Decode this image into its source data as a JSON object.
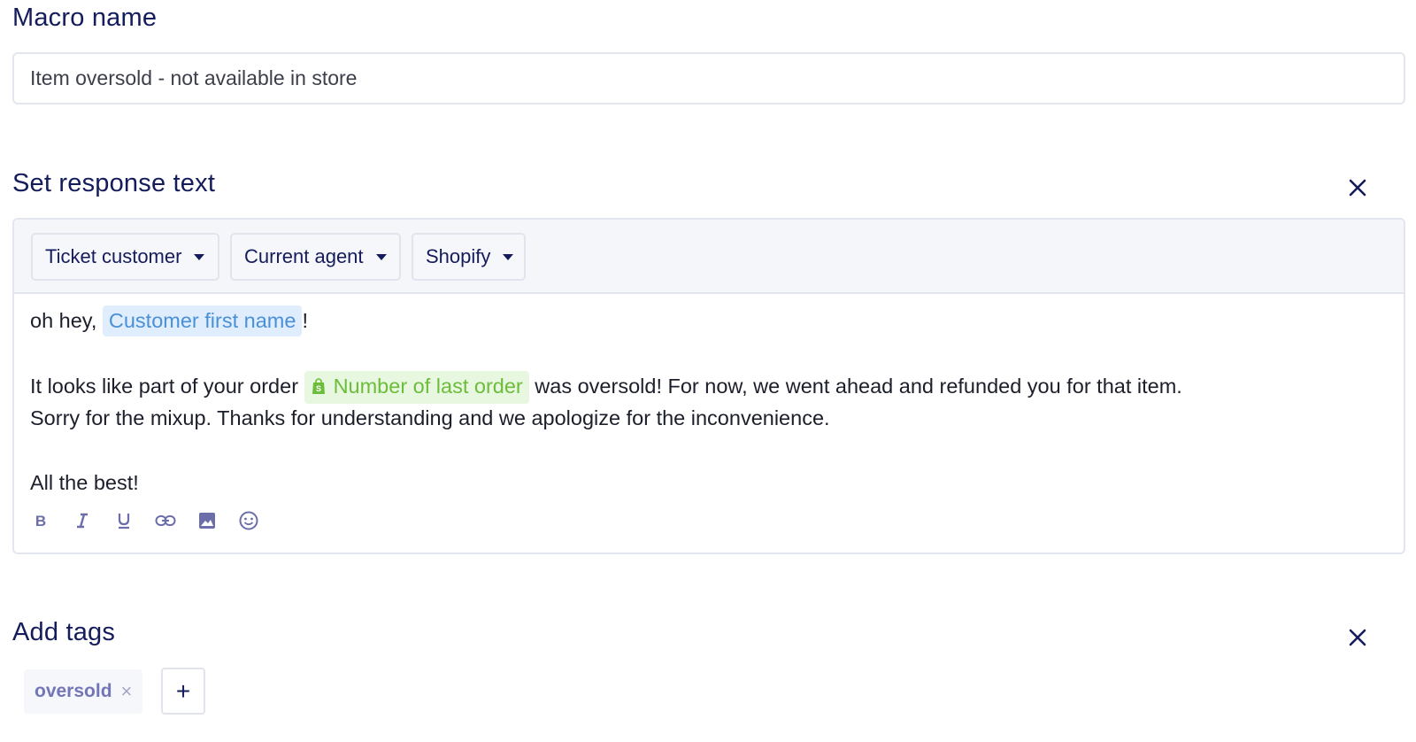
{
  "macro_name": {
    "label": "Macro name",
    "value": "Item oversold - not available in store"
  },
  "response": {
    "label": "Set response text",
    "close_icon": "close-icon",
    "variables": [
      {
        "label": "Ticket customer"
      },
      {
        "label": "Current agent"
      },
      {
        "label": "Shopify"
      }
    ],
    "body": {
      "greeting": "oh hey,",
      "greeting_var": "Customer first name",
      "greeting_end": "!",
      "para1_start": "It looks like part of your order",
      "para1_var": "Number of last order",
      "para1_end": "was oversold! For now, we went ahead and refunded you for that item.",
      "para2": "Sorry for the mixup. Thanks for understanding and we apologize for the inconvenience.",
      "signoff": "All the best!"
    },
    "chip_colors": {
      "customer": "#4a90d9",
      "shopify": "#6bbd3a"
    },
    "format_tools": [
      "bold-icon",
      "italic-icon",
      "underline-icon",
      "link-icon",
      "image-icon",
      "emoji-icon"
    ]
  },
  "tags": {
    "label": "Add tags",
    "items": [
      {
        "label": "oversold",
        "remove": "×"
      }
    ],
    "add_label": "+"
  },
  "colors": {
    "heading": "#141c5c",
    "border": "#e3e6ee",
    "toolbar_bg": "#f5f6fa"
  }
}
